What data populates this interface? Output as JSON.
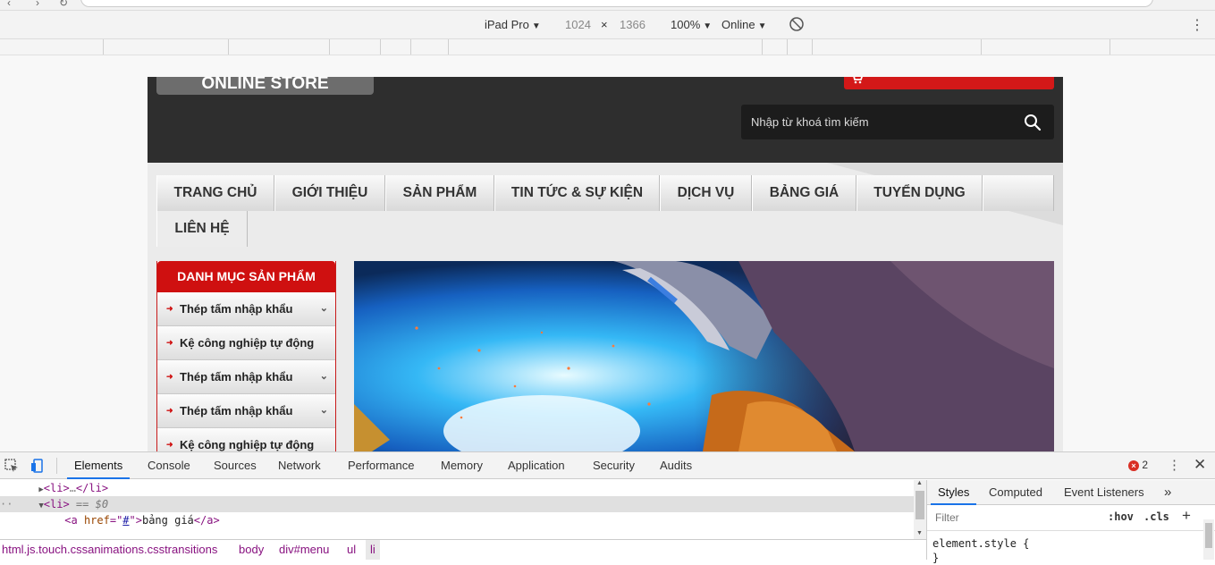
{
  "device_toolbar": {
    "device": "iPad Pro",
    "width": "1024",
    "times": "×",
    "height": "1366",
    "zoom": "100%",
    "network": "Online"
  },
  "site": {
    "logo_text": "ONLINE STORE",
    "search_placeholder": "Nhập từ khoá tìm kiếm",
    "nav": [
      "TRANG CHỦ",
      "GIỚI THIỆU",
      "SẢN PHẨM",
      "TIN TỨC & SỰ KIỆN",
      "DỊCH VỤ",
      "BẢNG GIÁ",
      "TUYỂN DỤNG",
      "LIÊN HỆ"
    ],
    "sidebar": {
      "title": "DANH MỤC SẢN PHẨM",
      "items": [
        "Thép tấm nhập khẩu",
        "Kệ công nghiệp tự động",
        "Thép tấm nhập khẩu",
        "Thép tấm nhập khẩu",
        "Kệ công nghiệp tự động"
      ]
    }
  },
  "devtools": {
    "tabs": [
      "Elements",
      "Console",
      "Sources",
      "Network",
      "Performance",
      "Memory",
      "Application",
      "Security",
      "Audits"
    ],
    "error_count": "2",
    "dom": {
      "line1_tag": "<li>",
      "line1_dots": "…",
      "line1_close": "</li>",
      "line2_tag": "<li>",
      "line2_marker": "== $0",
      "line3_open": "<a ",
      "line3_attr": "href",
      "line3_eq": "=\"",
      "line3_val": "#",
      "line3_q": "\">",
      "line3_text": "bảng giá",
      "line3_close": "</a>"
    },
    "breadcrumbs": [
      "html.js.touch.cssanimations.csstransitions",
      "body",
      "div#menu",
      "ul",
      "li"
    ],
    "styles_tabs": [
      "Styles",
      "Computed",
      "Event Listeners"
    ],
    "filter_placeholder": "Filter",
    "hov": ":hov",
    "cls": ".cls",
    "element_style": "element.style {",
    "element_style_close": "}"
  },
  "colors": {
    "header_bg": "#2e2e2e",
    "accent_red": "#cf1010",
    "devtools_active": "#1a73e8"
  }
}
